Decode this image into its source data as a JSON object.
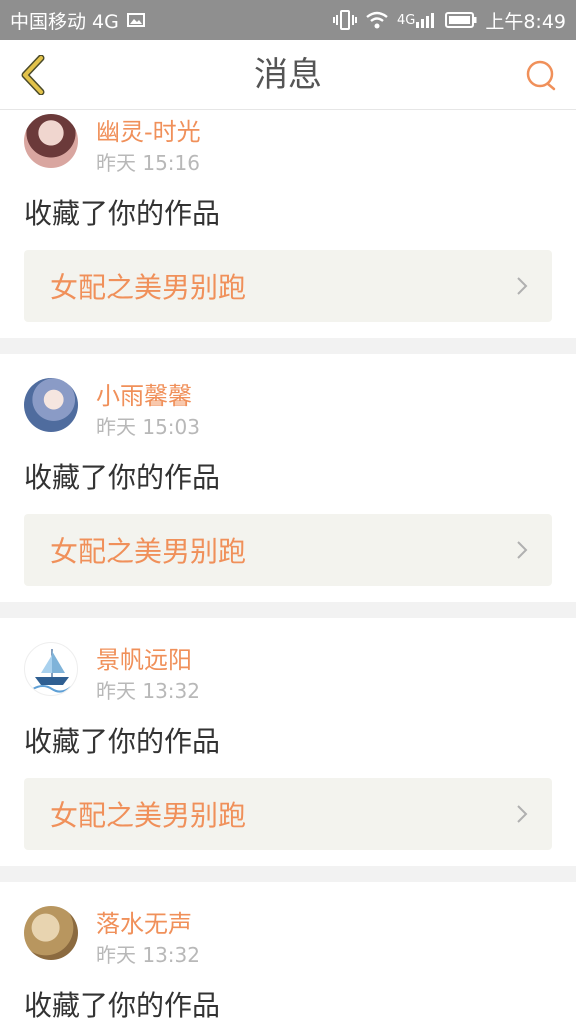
{
  "status_bar": {
    "carrier": "中国移动 4G",
    "network": "4G",
    "time": "上午8:49"
  },
  "header": {
    "title": "消息"
  },
  "messages": [
    {
      "user": "幽灵-时光",
      "time": "昨天 15:16",
      "action": "收藏了你的作品",
      "work": "女配之美男别跑"
    },
    {
      "user": "小雨馨馨",
      "time": "昨天 15:03",
      "action": "收藏了你的作品",
      "work": "女配之美男别跑"
    },
    {
      "user": "景帆远阳",
      "time": "昨天 13:32",
      "action": "收藏了你的作品",
      "work": "女配之美男别跑"
    },
    {
      "user": "落水无声",
      "time": "昨天 13:32",
      "action": "收藏了你的作品",
      "work": ""
    }
  ],
  "colors": {
    "accent": "#f0905a",
    "status_bar_bg": "#8f8f8f",
    "back_arrow": "#d6b13a",
    "card_link_bg": "#f3f3ee"
  }
}
